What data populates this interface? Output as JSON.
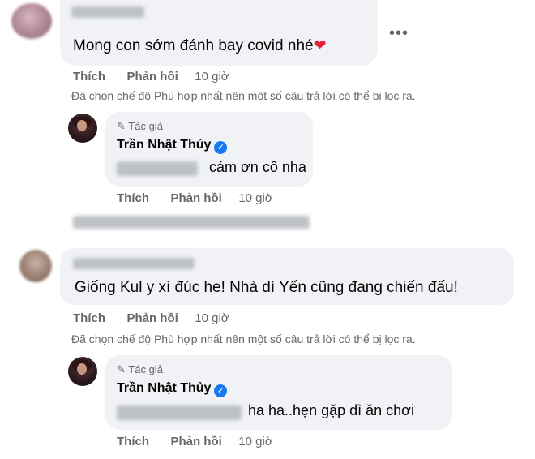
{
  "comments": [
    {
      "text": "Mong con sớm đánh bay covid nhé",
      "heart": "❤",
      "actions": {
        "like": "Thích",
        "reply": "Phản hồi",
        "time": "10 giờ"
      },
      "filter_note": "Đã chọn chế độ Phù hợp nhất nên một số câu trả lời có thể bị lọc ra.",
      "reply": {
        "author_label": "Tác giả",
        "author_name": "Trần Nhật Thủy",
        "verified_glyph": "✓",
        "text": "cám ơn cô nha",
        "actions": {
          "like": "Thích",
          "reply": "Phản hồi",
          "time": "10 giờ"
        }
      }
    },
    {
      "text": "Giống Kul y xì đúc he! Nhà dì Yến cũng đang chiến đấu!",
      "actions": {
        "like": "Thích",
        "reply": "Phản hồi",
        "time": "10 giờ"
      },
      "filter_note": "Đã chọn chế độ Phù hợp nhất nên một số câu trả lời có thể bị lọc ra.",
      "reply": {
        "author_label": "Tác giả",
        "author_name": "Trần Nhật Thủy",
        "verified_glyph": "✓",
        "text": "ha ha..hẹn gặp dì ăn chơi",
        "actions": {
          "like": "Thích",
          "reply": "Phản hồi",
          "time": "10 giờ"
        }
      }
    }
  ],
  "icons": {
    "more": "•••",
    "pencil": "✎"
  },
  "colors": {
    "bubble": "#f0f2f5",
    "secondary_text": "#65676b",
    "verified": "#1877f2",
    "heart": "#e0243a"
  }
}
